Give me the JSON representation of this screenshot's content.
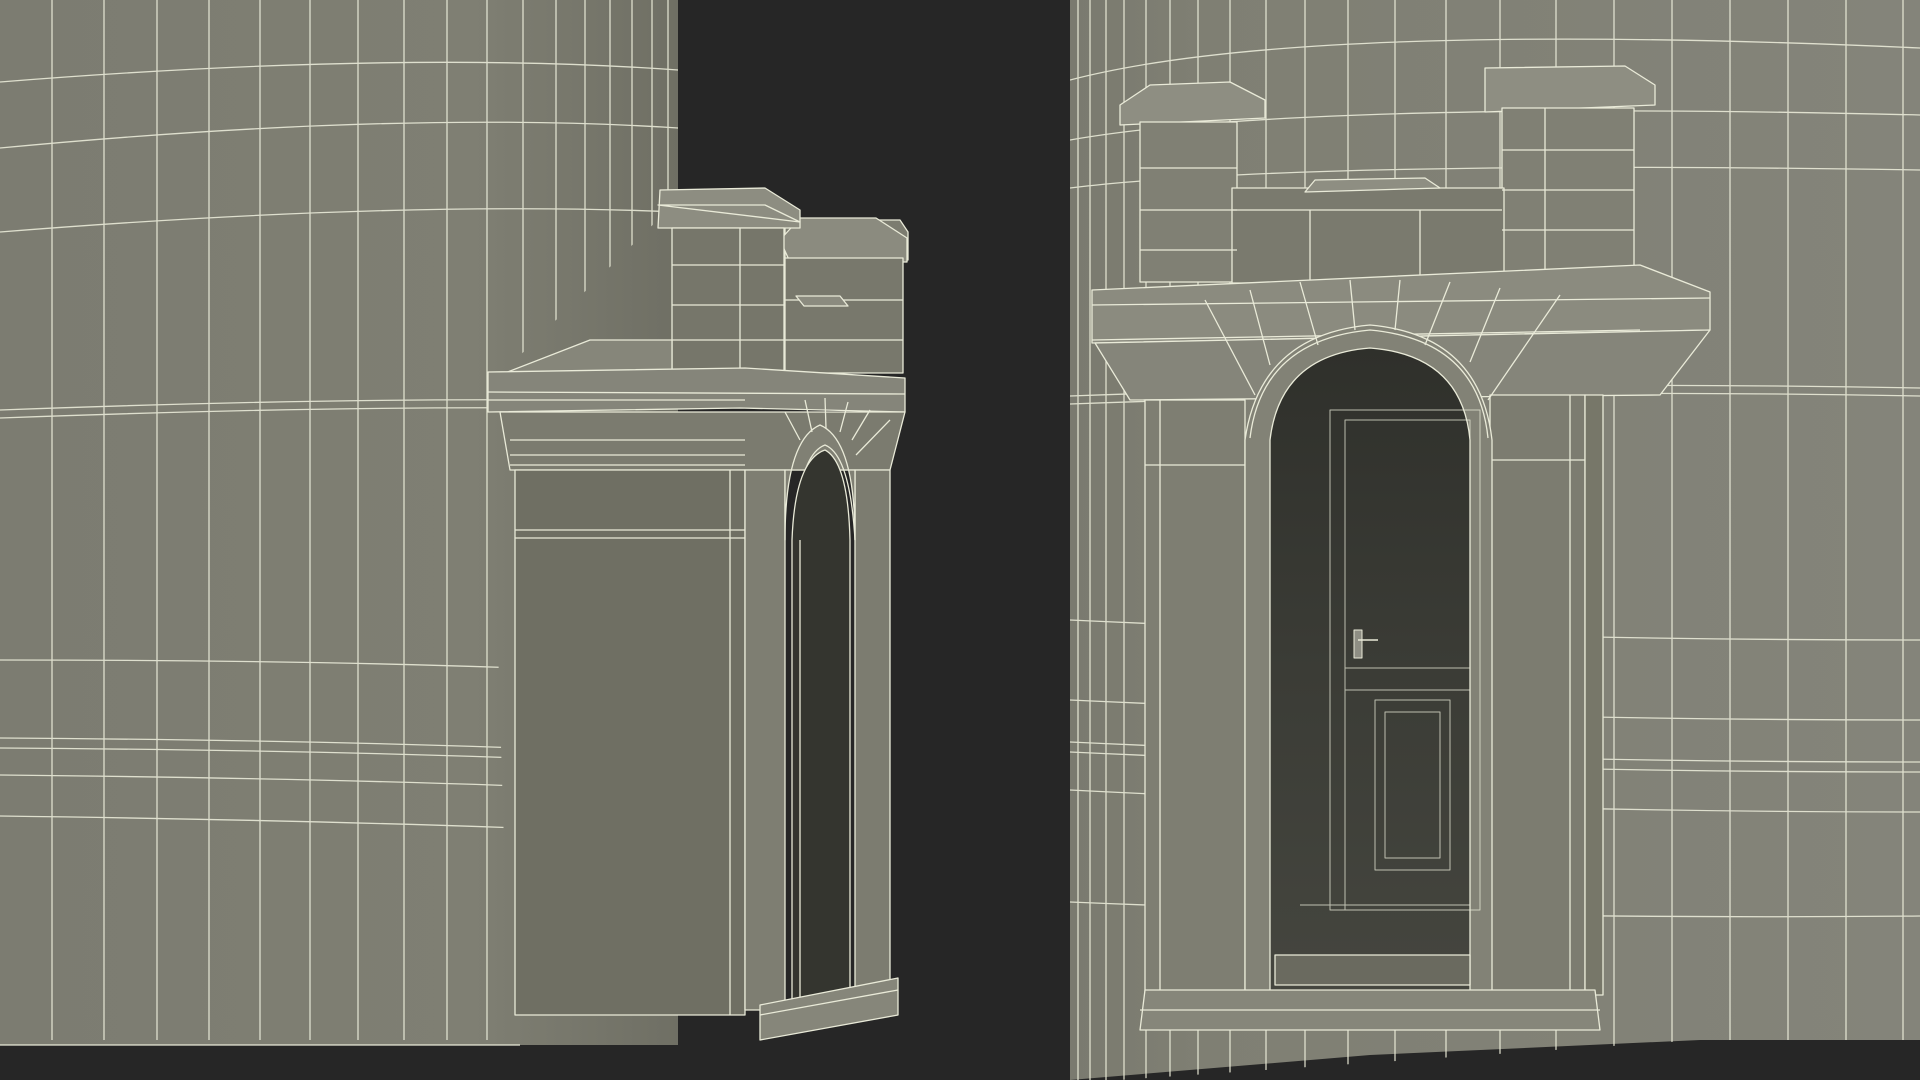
{
  "colors": {
    "background": "#262626",
    "wall": "#7e7e72",
    "wall_light": "#8a8a7e",
    "wall_dark": "#6a6a5f",
    "shadow": "#55554c",
    "interior": "#3e3f39",
    "interior_deep": "#2f302b",
    "wire": "#e9ead8"
  }
}
